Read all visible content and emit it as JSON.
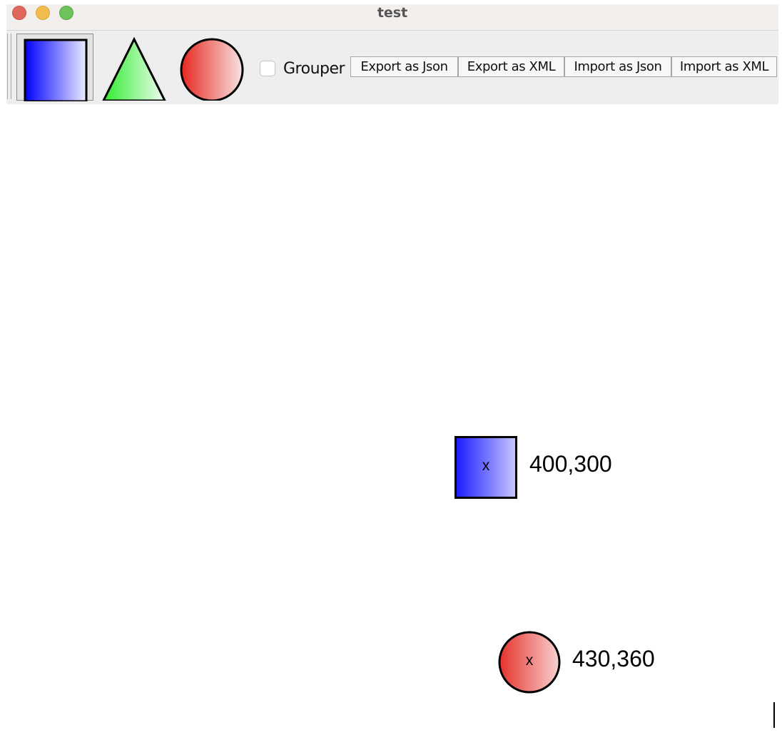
{
  "window": {
    "title": "test"
  },
  "toolbar": {
    "tools": [
      {
        "name": "rectangle",
        "icon": "square-icon",
        "selected": true,
        "fill_from": "#0000ff",
        "fill_to": "#e8e8ff"
      },
      {
        "name": "triangle",
        "icon": "triangle-icon",
        "selected": false,
        "fill_from": "#33ee33",
        "fill_to": "#eefeee"
      },
      {
        "name": "circle",
        "icon": "circle-icon",
        "selected": false,
        "fill_from": "#e8261f",
        "fill_to": "#f6e0e0"
      }
    ],
    "grouper": {
      "label": "Grouper",
      "checked": false
    },
    "buttons": {
      "export_json": "Export as Json",
      "export_xml": "Export as XML",
      "import_json": "Import as Json",
      "import_xml": "Import as XML"
    }
  },
  "canvas": {
    "shapes": [
      {
        "type": "rectangle",
        "marker": "x",
        "label": "400,300",
        "fill_from": "#1a1aff",
        "fill_to": "#c4c4ff"
      },
      {
        "type": "circle",
        "marker": "x",
        "label": "430,360",
        "fill_from": "#e5322c",
        "fill_to": "#f6cccc"
      }
    ]
  },
  "colors": {
    "titlebar": "#f3efed",
    "toolbar": "#eeeeee",
    "canvas": "#ffffff"
  }
}
